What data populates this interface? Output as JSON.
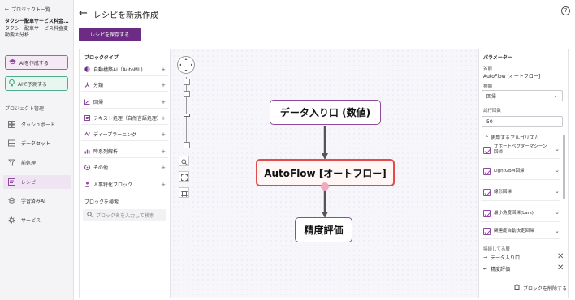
{
  "sidebar": {
    "back_label": "プロジェクト一覧",
    "project_name": "タクシー配車サービス料金...",
    "project_desc": "タクシー配車サービス料金変動要因分析",
    "ai_create": "AIを作成する",
    "ai_predict": "AIで予測する",
    "section_label": "プロジェクト管理",
    "nav": [
      {
        "label": "ダッシュボード",
        "icon": "dashboard-icon"
      },
      {
        "label": "データセット",
        "icon": "dataset-icon"
      },
      {
        "label": "前処理",
        "icon": "preprocess-icon"
      },
      {
        "label": "レシピ",
        "icon": "recipe-icon",
        "active": true
      },
      {
        "label": "学習済みAI",
        "icon": "trained-ai-icon"
      },
      {
        "label": "サービス",
        "icon": "service-icon"
      }
    ]
  },
  "header": {
    "title": "レシピを新規作成",
    "save_label": "レシピを保存する",
    "help_glyph": "?"
  },
  "block_panel": {
    "title": "ブロックタイプ",
    "items": [
      {
        "label": "自動構築AI（AutoML)",
        "icon": "automl-icon"
      },
      {
        "label": "分類",
        "icon": "classification-icon"
      },
      {
        "label": "回帰",
        "icon": "regression-icon"
      },
      {
        "label": "テキスト処理（自然言語処理）",
        "icon": "text-icon"
      },
      {
        "label": "ディープラーニング",
        "icon": "deep-learning-icon"
      },
      {
        "label": "時系列解析",
        "icon": "timeseries-icon"
      },
      {
        "label": "その他",
        "icon": "other-icon"
      },
      {
        "label": "人事特化ブロック",
        "icon": "hr-icon"
      }
    ],
    "search_label": "ブロックを検索",
    "search_placeholder": "ブロック名を入力して検索"
  },
  "canvas": {
    "nodes": {
      "data_input": "データ入り口 (数値)",
      "autoflow": "AutoFlow [オートフロー]",
      "evaluation": "精度評価"
    }
  },
  "params": {
    "title": "パラメーター",
    "name_label": "名前",
    "name_value": "AutoFlow [オートフロー]",
    "type_label": "種類",
    "type_value": "回帰",
    "trials_label": "試行回数",
    "trials_value": "50",
    "algo_header": "使用するアルゴリズム",
    "algorithms": [
      "サポートベクターマシーン回帰",
      "LightGBM回帰",
      "線形回帰",
      "最小角度回帰(Lars)",
      "関連度自動決定回帰"
    ],
    "connected_label": "接続してる層",
    "connections": [
      {
        "label": "データ入り口",
        "direction": "in"
      },
      {
        "label": "精度評価",
        "direction": "out"
      }
    ],
    "delete_label": "ブロックを削除する"
  },
  "colors": {
    "brand": "#6c2c86",
    "node_border": "#8f4aa0",
    "selected_border": "#e34a4a"
  }
}
